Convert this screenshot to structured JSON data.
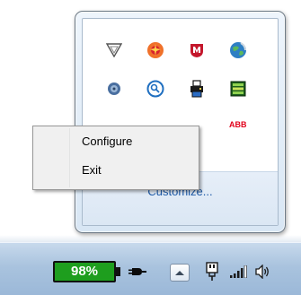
{
  "overflow_flyout": {
    "customize_label": "Customize...",
    "tray_icons": [
      {
        "name": "triangle-icon"
      },
      {
        "name": "red-orange-star-icon"
      },
      {
        "name": "mcafee-shield-icon"
      },
      {
        "name": "globe-icon"
      },
      {
        "name": "disc-icon"
      },
      {
        "name": "search-circle-icon"
      },
      {
        "name": "printer-icon"
      },
      {
        "name": "green-grid-icon"
      },
      {
        "name": "abb-logo-icon"
      }
    ]
  },
  "context_menu": {
    "items": [
      {
        "label": "Configure"
      },
      {
        "label": "Exit"
      }
    ]
  },
  "taskbar": {
    "battery_percent_label": "98%",
    "battery_level": 0.98,
    "icons": [
      "power-plug-icon",
      "show-hidden-icons-button",
      "network-plug-icon",
      "signal-bars-icon",
      "speaker-icon"
    ]
  }
}
